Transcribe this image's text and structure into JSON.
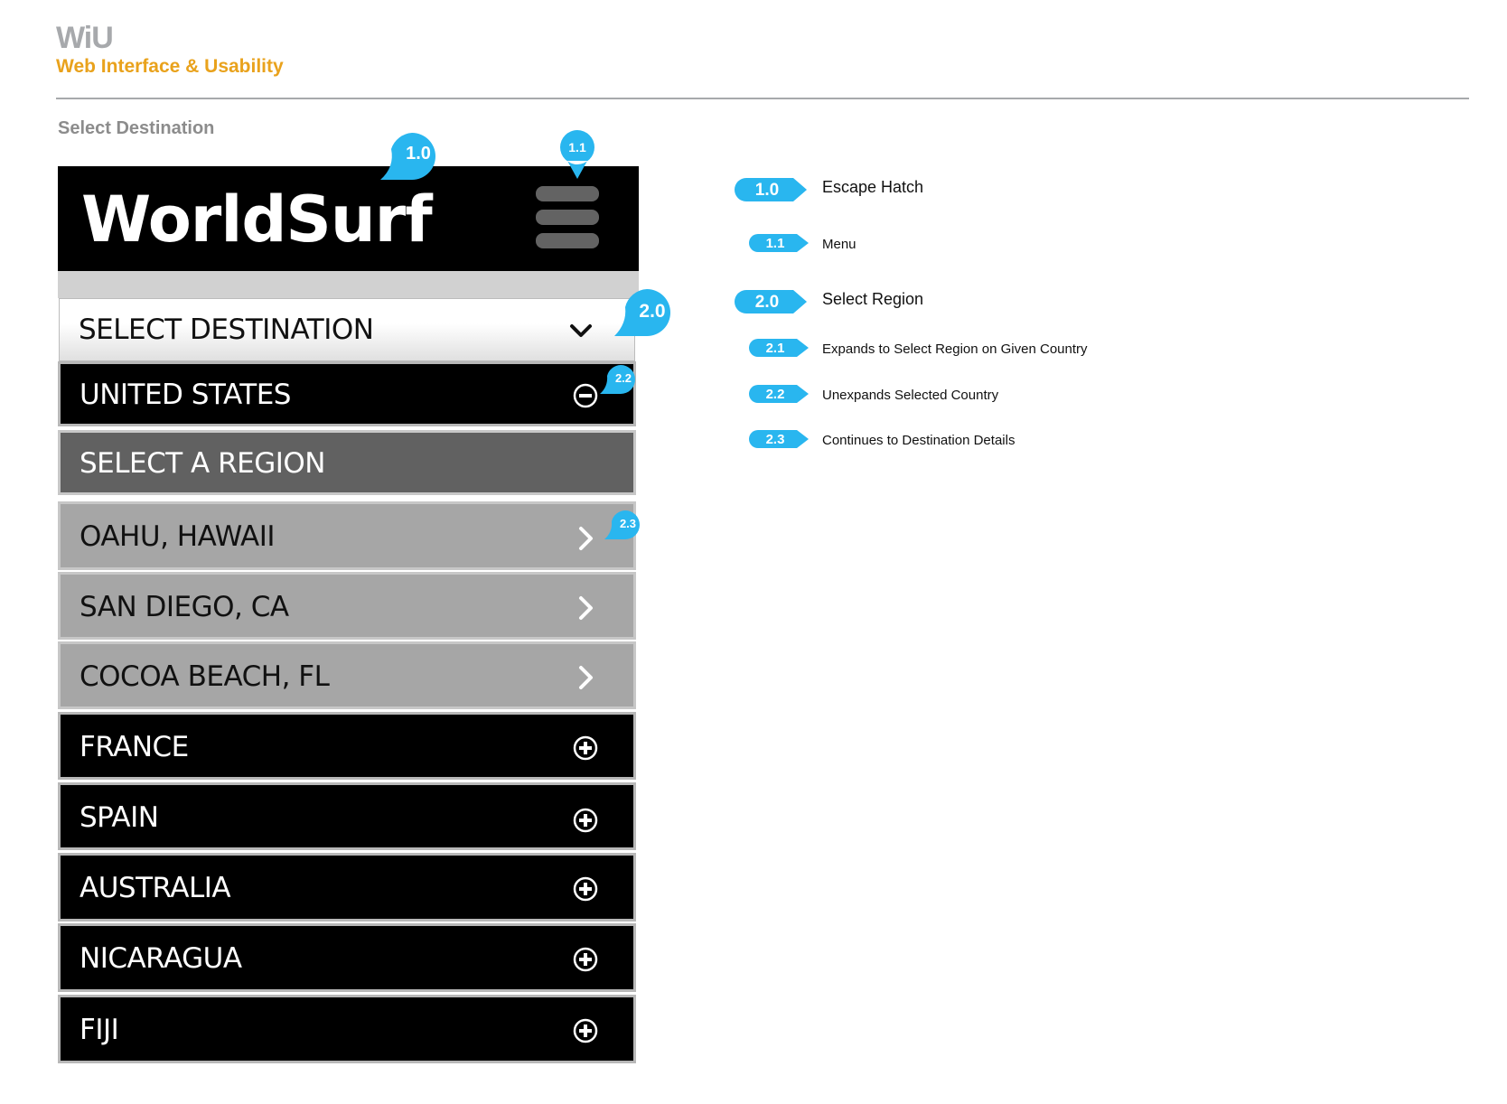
{
  "header": {
    "brand": "WiU",
    "subtitle": "Web Interface & Usability",
    "section_title": "Select Destination"
  },
  "app": {
    "logo": "WorldSurf",
    "menu_icon": "hamburger-icon",
    "select_label": "SELECT DESTINATION",
    "select_icon": "chevron-down-icon",
    "expanded_country": {
      "label": "UNITED STATES",
      "icon": "minus-circle-icon"
    },
    "region_header": "SELECT A REGION",
    "regions": [
      {
        "label": "OAHU, HAWAII",
        "icon": "chevron-right-icon"
      },
      {
        "label": "SAN DIEGO, CA",
        "icon": "chevron-right-icon"
      },
      {
        "label": "COCOA BEACH, FL",
        "icon": "chevron-right-icon"
      }
    ],
    "countries": [
      {
        "label": "FRANCE",
        "icon": "plus-circle-icon"
      },
      {
        "label": "SPAIN",
        "icon": "plus-circle-icon"
      },
      {
        "label": "AUSTRALIA",
        "icon": "plus-circle-icon"
      },
      {
        "label": "NICARAGUA",
        "icon": "plus-circle-icon"
      },
      {
        "label": "FIJI",
        "icon": "plus-circle-icon"
      }
    ]
  },
  "callouts": [
    "1.0",
    "1.1",
    "2.0",
    "2.2",
    "2.3"
  ],
  "legend": [
    {
      "num": "1.0",
      "text": "Escape Hatch"
    },
    {
      "num": "1.1",
      "text": "Menu"
    },
    {
      "num": "2.0",
      "text": "Select Region"
    },
    {
      "num": "2.1",
      "text": "Expands to Select Region on Given Country"
    },
    {
      "num": "2.2",
      "text": "Unexpands Selected Country"
    },
    {
      "num": "2.3",
      "text": "Continues to Destination Details"
    }
  ],
  "colors": {
    "callout_blue": "#29b6ef",
    "brand_gray": "#a7a9ac",
    "brand_orange": "#e9a21c"
  }
}
